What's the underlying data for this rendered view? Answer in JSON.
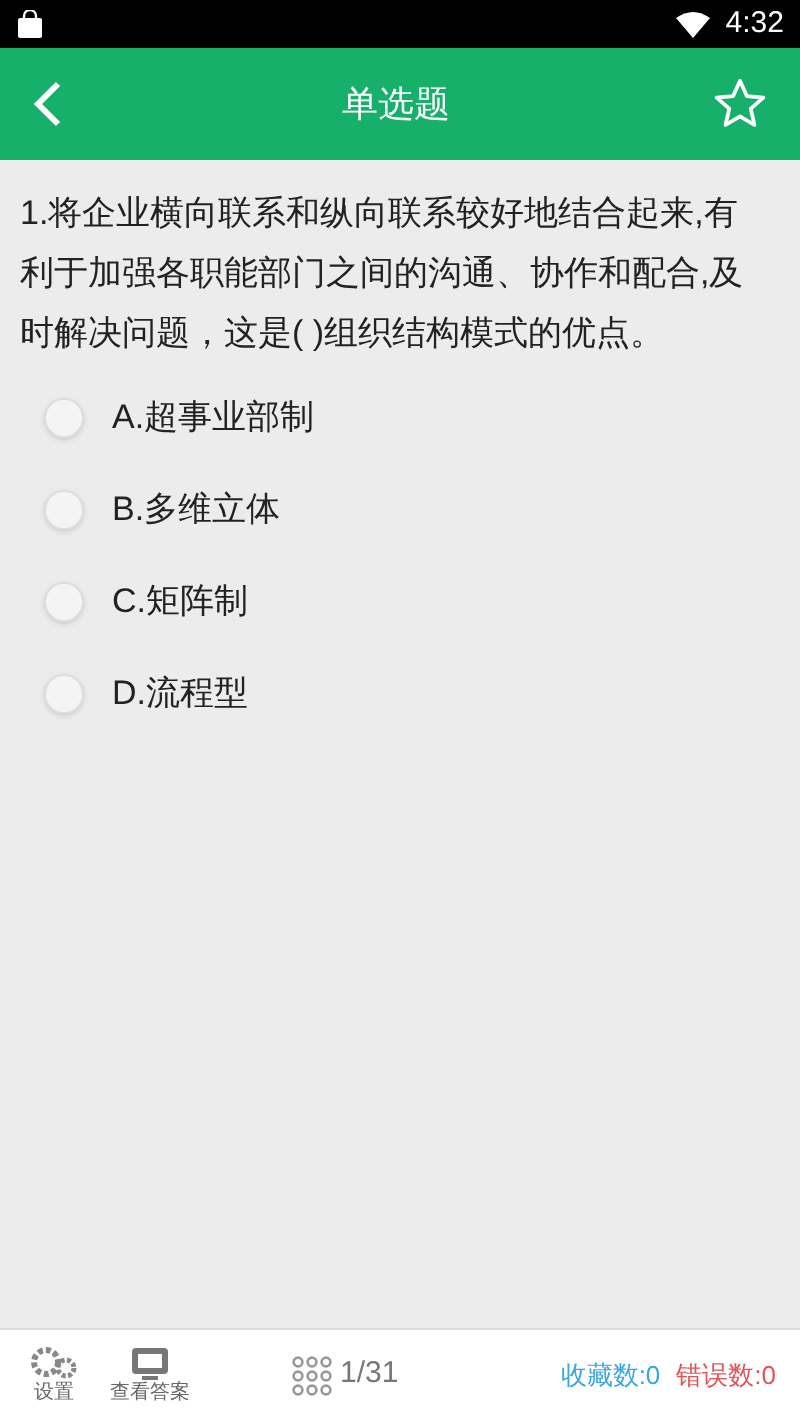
{
  "status_bar": {
    "time": "4:32"
  },
  "header": {
    "title": "单选题",
    "favorited": false
  },
  "question": {
    "text": "1.将企业横向联系和纵向联系较好地结合起来,有利于加强各职能部门之间的沟通、协作和配合,及时解决问题，这是( )组织结构模式的优点。"
  },
  "options": [
    {
      "label": "A.超事业部制",
      "selected": false
    },
    {
      "label": "B.多维立体",
      "selected": false
    },
    {
      "label": "C.矩阵制",
      "selected": false
    },
    {
      "label": "D.流程型",
      "selected": false
    }
  ],
  "bottom_bar": {
    "settings": "设置",
    "view_answer": "查看答案",
    "progress": "1/31",
    "favorites": "收藏数:0",
    "errors": "错误数:0"
  }
}
